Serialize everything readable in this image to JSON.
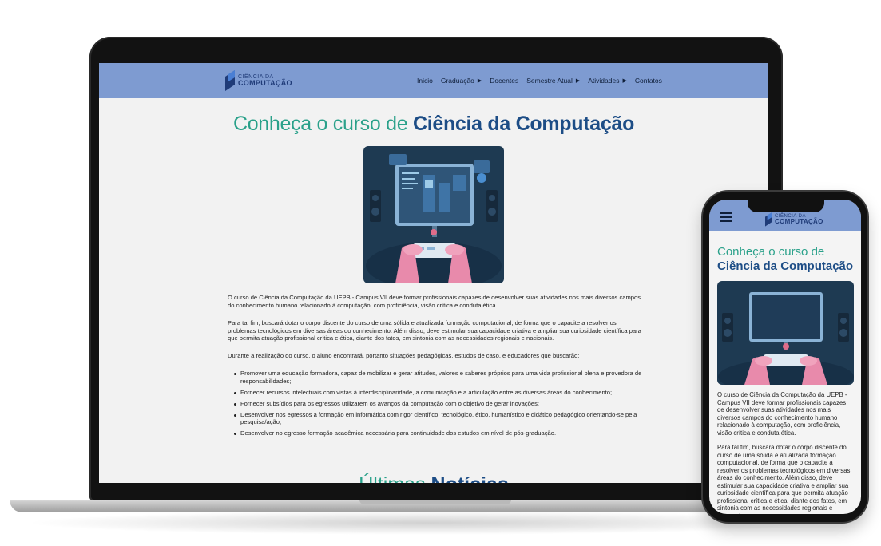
{
  "site": {
    "logo_small": "CIÊNCIA DA",
    "logo_big": "COMPUTAÇÃO"
  },
  "nav": [
    {
      "label": "Inicio",
      "has_caret": false
    },
    {
      "label": "Graduação",
      "has_caret": true
    },
    {
      "label": "Docentes",
      "has_caret": false
    },
    {
      "label": "Semestre Atual",
      "has_caret": true
    },
    {
      "label": "Atividades",
      "has_caret": true
    },
    {
      "label": "Contatos",
      "has_caret": false
    }
  ],
  "heading": {
    "light": "Conheça o curso de ",
    "bold": "Ciência da Computação"
  },
  "paragraphs": [
    "O curso de Ciência da Computação da UEPB - Campus VII deve formar profissionais capazes de desenvolver suas atividades nos mais diversos campos do conhecimento humano relacionado à computação, com proficiência, visão crítica e conduta ética.",
    "Para tal fim, buscará dotar o corpo discente do curso de uma sólida e atualizada formação computacional, de forma que o capacite a resolver os problemas tecnológicos em diversas áreas do conhecimento. Além disso, deve estimular sua capacidade criativa e ampliar sua curiosidade científica para que permita atuação profissional crítica e ética, diante dos fatos, em sintonia com as necessidades regionais e nacionais.",
    "Durante a realização do curso, o aluno encontrará, portanto situações pedagógicas, estudos de caso, e educadores que buscarão:"
  ],
  "bullets": [
    "Promover uma educação formadora, capaz de mobilizar e gerar atitudes, valores e saberes próprios para uma vida profissional plena e provedora de responsabilidades;",
    "Fornecer recursos intelectuais com vistas à interdisciplinaridade, a comunicação e a articulação entre as diversas áreas do conhecimento;",
    "Fornecer subsídios para os egressos utilizarem os avanços da computação com o objetivo de gerar inovações;",
    "Desenvolver nos egressos a formação em informática com rigor científico, tecnológico, ético, humanístico e didático pedagógico orientando-se pela pesquisa/ação;",
    "Desenvolver no egresso formação acadêmica necessária para continuidade dos estudos em nível de pós-graduação."
  ],
  "news_heading": {
    "light": "Últimas ",
    "bold": "Notícias"
  },
  "phone": {
    "heading_light": "Conheça o curso de",
    "heading_bold": "Ciência da Computação",
    "paragraphs": [
      "O curso de Ciência da Computação da UEPB - Campus VII deve formar profissionais capazes de desenvolver suas atividades nos mais diversos campos do conhecimento humano relacionado à computação, com proficiência, visão crítica e conduta ética.",
      "Para tal fim, buscará dotar o corpo discente do curso de uma sólida e atualizada formação computacional, de forma que o capacite a resolver os problemas tecnológicos em diversas áreas do conhecimento. Além disso, deve estimular sua capacidade criativa e ampliar sua curiosidade científica para que permita atuação profissional crítica e ética, diante dos fatos, em sintonia com as necessidades regionais e nacionais."
    ]
  },
  "colors": {
    "nav_bg": "#7e9bd1",
    "heading_teal": "#2aa18a",
    "heading_blue": "#1d4d86",
    "illustration_bg": "#1e3a52"
  }
}
